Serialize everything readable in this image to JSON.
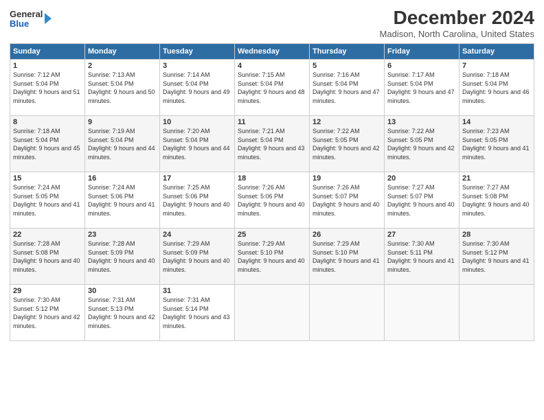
{
  "logo": {
    "general": "General",
    "blue": "Blue"
  },
  "header": {
    "month": "December 2024",
    "location": "Madison, North Carolina, United States"
  },
  "days_of_week": [
    "Sunday",
    "Monday",
    "Tuesday",
    "Wednesday",
    "Thursday",
    "Friday",
    "Saturday"
  ],
  "weeks": [
    [
      {
        "day": "1",
        "sunrise": "7:12 AM",
        "sunset": "5:04 PM",
        "daylight": "9 hours and 51 minutes."
      },
      {
        "day": "2",
        "sunrise": "7:13 AM",
        "sunset": "5:04 PM",
        "daylight": "9 hours and 50 minutes."
      },
      {
        "day": "3",
        "sunrise": "7:14 AM",
        "sunset": "5:04 PM",
        "daylight": "9 hours and 49 minutes."
      },
      {
        "day": "4",
        "sunrise": "7:15 AM",
        "sunset": "5:04 PM",
        "daylight": "9 hours and 48 minutes."
      },
      {
        "day": "5",
        "sunrise": "7:16 AM",
        "sunset": "5:04 PM",
        "daylight": "9 hours and 47 minutes."
      },
      {
        "day": "6",
        "sunrise": "7:17 AM",
        "sunset": "5:04 PM",
        "daylight": "9 hours and 47 minutes."
      },
      {
        "day": "7",
        "sunrise": "7:18 AM",
        "sunset": "5:04 PM",
        "daylight": "9 hours and 46 minutes."
      }
    ],
    [
      {
        "day": "8",
        "sunrise": "7:18 AM",
        "sunset": "5:04 PM",
        "daylight": "9 hours and 45 minutes."
      },
      {
        "day": "9",
        "sunrise": "7:19 AM",
        "sunset": "5:04 PM",
        "daylight": "9 hours and 44 minutes."
      },
      {
        "day": "10",
        "sunrise": "7:20 AM",
        "sunset": "5:04 PM",
        "daylight": "9 hours and 44 minutes."
      },
      {
        "day": "11",
        "sunrise": "7:21 AM",
        "sunset": "5:04 PM",
        "daylight": "9 hours and 43 minutes."
      },
      {
        "day": "12",
        "sunrise": "7:22 AM",
        "sunset": "5:05 PM",
        "daylight": "9 hours and 42 minutes."
      },
      {
        "day": "13",
        "sunrise": "7:22 AM",
        "sunset": "5:05 PM",
        "daylight": "9 hours and 42 minutes."
      },
      {
        "day": "14",
        "sunrise": "7:23 AM",
        "sunset": "5:05 PM",
        "daylight": "9 hours and 41 minutes."
      }
    ],
    [
      {
        "day": "15",
        "sunrise": "7:24 AM",
        "sunset": "5:05 PM",
        "daylight": "9 hours and 41 minutes."
      },
      {
        "day": "16",
        "sunrise": "7:24 AM",
        "sunset": "5:06 PM",
        "daylight": "9 hours and 41 minutes."
      },
      {
        "day": "17",
        "sunrise": "7:25 AM",
        "sunset": "5:06 PM",
        "daylight": "9 hours and 40 minutes."
      },
      {
        "day": "18",
        "sunrise": "7:26 AM",
        "sunset": "5:06 PM",
        "daylight": "9 hours and 40 minutes."
      },
      {
        "day": "19",
        "sunrise": "7:26 AM",
        "sunset": "5:07 PM",
        "daylight": "9 hours and 40 minutes."
      },
      {
        "day": "20",
        "sunrise": "7:27 AM",
        "sunset": "5:07 PM",
        "daylight": "9 hours and 40 minutes."
      },
      {
        "day": "21",
        "sunrise": "7:27 AM",
        "sunset": "5:08 PM",
        "daylight": "9 hours and 40 minutes."
      }
    ],
    [
      {
        "day": "22",
        "sunrise": "7:28 AM",
        "sunset": "5:08 PM",
        "daylight": "9 hours and 40 minutes."
      },
      {
        "day": "23",
        "sunrise": "7:28 AM",
        "sunset": "5:09 PM",
        "daylight": "9 hours and 40 minutes."
      },
      {
        "day": "24",
        "sunrise": "7:29 AM",
        "sunset": "5:09 PM",
        "daylight": "9 hours and 40 minutes."
      },
      {
        "day": "25",
        "sunrise": "7:29 AM",
        "sunset": "5:10 PM",
        "daylight": "9 hours and 40 minutes."
      },
      {
        "day": "26",
        "sunrise": "7:29 AM",
        "sunset": "5:10 PM",
        "daylight": "9 hours and 41 minutes."
      },
      {
        "day": "27",
        "sunrise": "7:30 AM",
        "sunset": "5:11 PM",
        "daylight": "9 hours and 41 minutes."
      },
      {
        "day": "28",
        "sunrise": "7:30 AM",
        "sunset": "5:12 PM",
        "daylight": "9 hours and 41 minutes."
      }
    ],
    [
      {
        "day": "29",
        "sunrise": "7:30 AM",
        "sunset": "5:12 PM",
        "daylight": "9 hours and 42 minutes."
      },
      {
        "day": "30",
        "sunrise": "7:31 AM",
        "sunset": "5:13 PM",
        "daylight": "9 hours and 42 minutes."
      },
      {
        "day": "31",
        "sunrise": "7:31 AM",
        "sunset": "5:14 PM",
        "daylight": "9 hours and 43 minutes."
      },
      null,
      null,
      null,
      null
    ]
  ]
}
